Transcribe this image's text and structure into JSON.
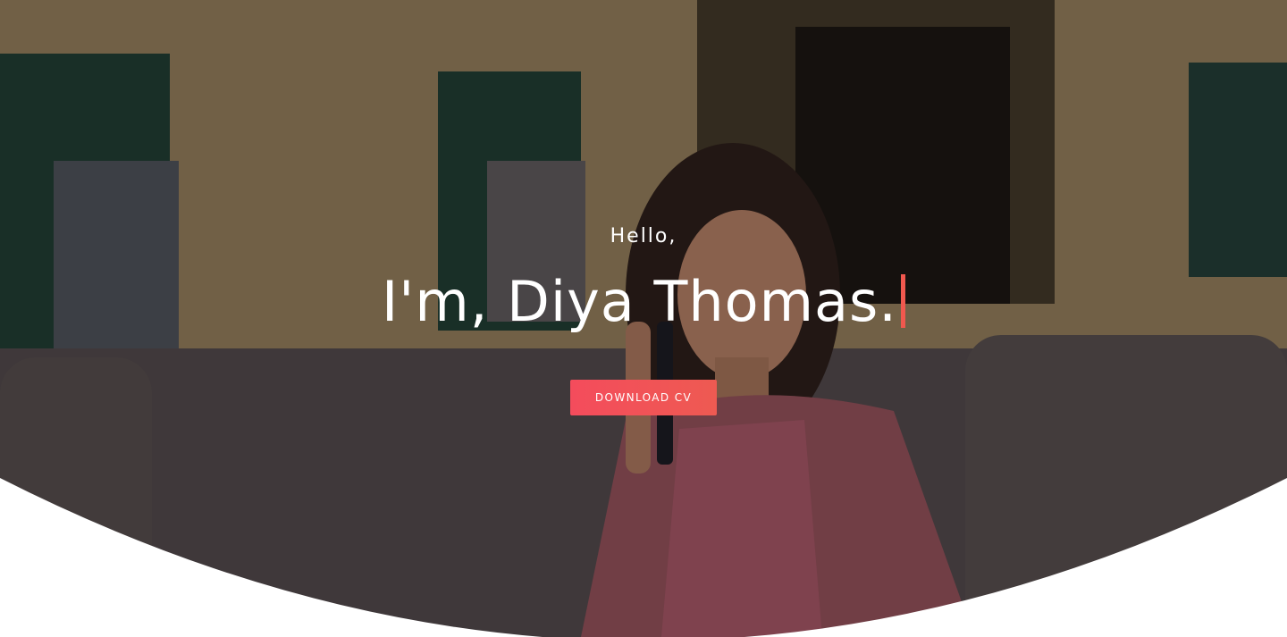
{
  "hero": {
    "greeting": "Hello,",
    "headline": "I'm, Diya Thomas.",
    "cta_label": "DOWNLOAD CV"
  },
  "colors": {
    "accent": "#f0584e",
    "button_start": "#f44c5c",
    "button_end": "#ee5a52",
    "text": "#ffffff"
  },
  "icons": {
    "typing_cursor": "text-cursor-icon"
  }
}
